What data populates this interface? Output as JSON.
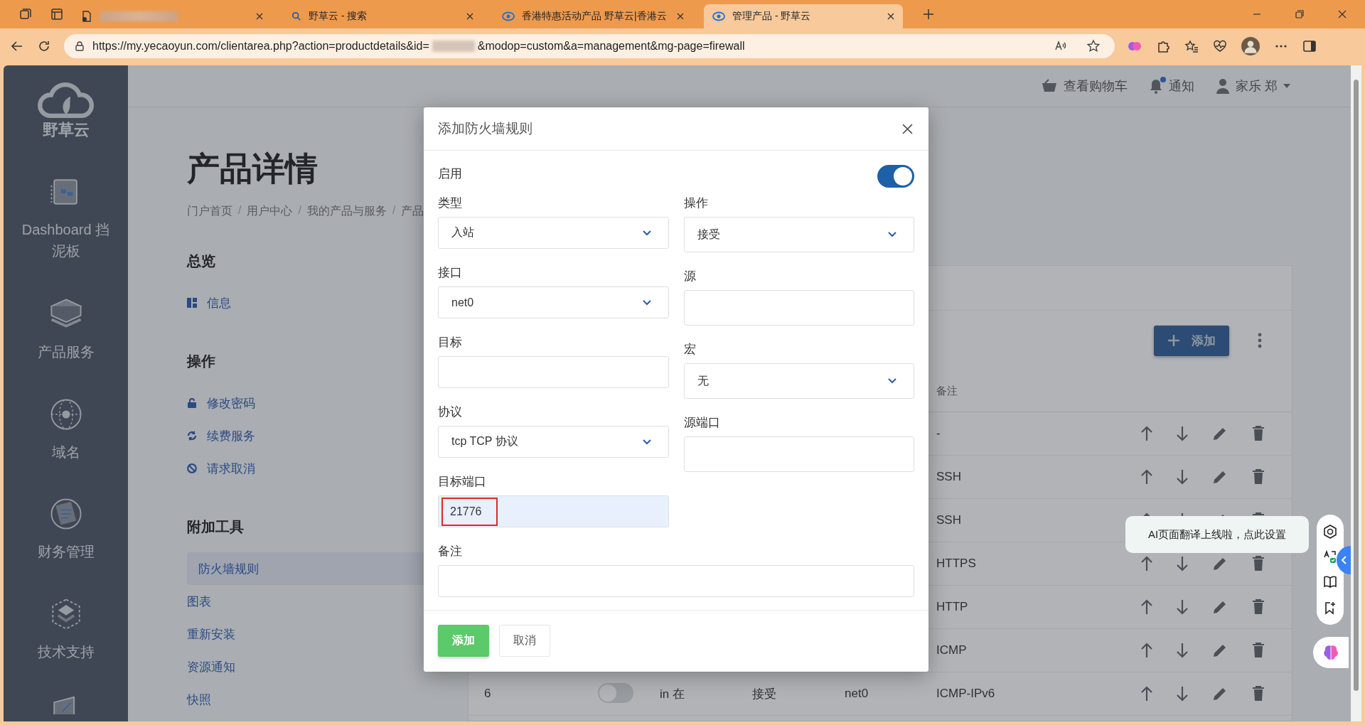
{
  "browser": {
    "tabs": [
      {
        "redacted": true,
        "selected": false
      },
      {
        "title": "野草云 - 搜索",
        "redacted": false,
        "selected": false
      },
      {
        "title": "香港特惠活动产品 野草云|香港云",
        "redacted": false,
        "selected": false
      },
      {
        "title": "管理产品 - 野草云",
        "redacted": false,
        "selected": true
      }
    ],
    "address": {
      "before": "https://my.yecaoyun.com/clientarea.php?action=productdetails&id=",
      "redacted": true,
      "after": "&modop=custom&a=management&mg-page=firewall"
    }
  },
  "sidebar": {
    "logo": "野草云",
    "items": [
      {
        "label": "Dashboard 挡泥板"
      },
      {
        "label": "产品服务"
      },
      {
        "label": "域名"
      },
      {
        "label": "财务管理"
      },
      {
        "label": "技术支持"
      }
    ]
  },
  "header": {
    "cart": "查看购物车",
    "notifications": "通知",
    "unread": true,
    "user": "家乐 郑"
  },
  "page": {
    "title": "产品详情",
    "breadcrumb": [
      "门户首页",
      "用户中心",
      "我的产品与服务",
      "产品"
    ],
    "breadcrumb_separator": "/",
    "sections": [
      {
        "title": "总览",
        "links": [
          {
            "label": "信息",
            "selected": false
          }
        ]
      },
      {
        "title": "操作",
        "links": [
          {
            "label": "修改密码",
            "selected": false
          },
          {
            "label": "续费服务",
            "selected": false
          },
          {
            "label": "请求取消",
            "selected": false
          }
        ]
      },
      {
        "title": "附加工具",
        "links": [
          {
            "label": "防火墙规则",
            "selected": true
          },
          {
            "label": "图表",
            "selected": false
          },
          {
            "label": "重新安装",
            "selected": false
          },
          {
            "label": "资源通知",
            "selected": false
          },
          {
            "label": "快照",
            "selected": false
          }
        ]
      }
    ]
  },
  "table": {
    "add_button": "添加",
    "columns": [
      {
        "label": "备注"
      }
    ],
    "rows": [
      {
        "remark": "-"
      },
      {
        "remark": "SSH"
      },
      {
        "remark": "SSH"
      },
      {
        "remark": "HTTPS"
      },
      {
        "remark": "HTTP"
      },
      {
        "remark": "ICMP"
      },
      {
        "number": "6",
        "enabled": false,
        "direction": "in 在",
        "action": "接受",
        "interface": "net0",
        "remark": "ICMP-IPv6"
      }
    ]
  },
  "modal": {
    "title": "添加防火墙规则",
    "enable_label": "启用",
    "enabled": true,
    "left": [
      {
        "label": "类型",
        "kind": "select",
        "value": "入站"
      },
      {
        "label": "接口",
        "kind": "select",
        "value": "net0"
      },
      {
        "label": "目标",
        "kind": "input"
      },
      {
        "label": "协议",
        "kind": "select",
        "value": "tcp TCP 协议"
      },
      {
        "label": "目标端口",
        "kind": "input",
        "value": "21776",
        "autofilled": true,
        "highlighted": true
      }
    ],
    "right": [
      {
        "label": "操作",
        "kind": "select",
        "value": "接受"
      },
      {
        "label": "源",
        "kind": "input"
      },
      {
        "label": "宏",
        "kind": "select",
        "value": "无"
      },
      {
        "label": "源端口",
        "kind": "input"
      }
    ],
    "note": {
      "label": "备注",
      "kind": "input"
    },
    "submit": "添加",
    "cancel": "取消"
  },
  "assistant": {
    "tooltip": "AI页面翻译上线啦，点此设置"
  }
}
